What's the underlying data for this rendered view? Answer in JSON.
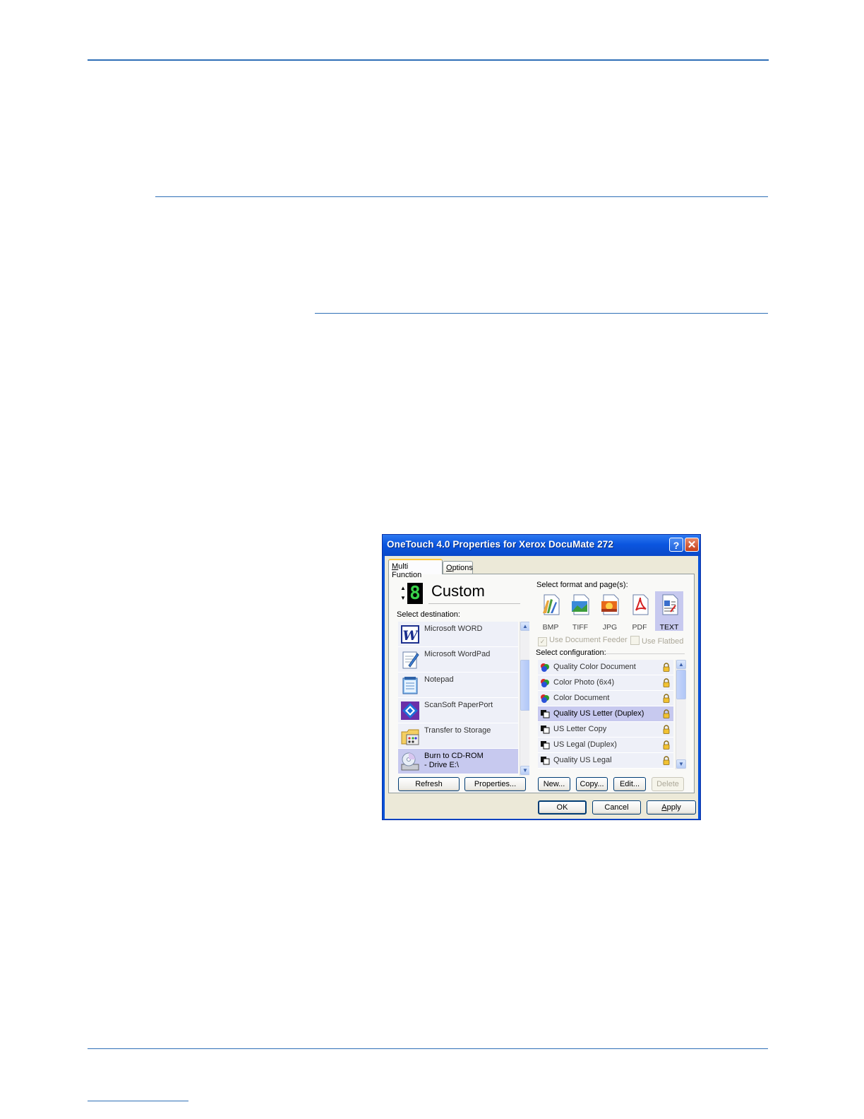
{
  "dialog": {
    "title": "OneTouch 4.0 Properties for Xerox DocuMate 272",
    "help_glyph": "?",
    "close_glyph": "✕",
    "tabs": [
      {
        "prefix": "",
        "accel": "M",
        "rest": "ulti Function"
      },
      {
        "prefix": "",
        "accel": "O",
        "rest": "ptions"
      }
    ],
    "button_number": "8",
    "spin_up": "▲",
    "spin_down": "▼",
    "profile_name": "Custom",
    "select_destination_label": "Select destination:",
    "destinations": [
      {
        "label": "Microsoft WORD",
        "icon": "word-icon",
        "selected": false
      },
      {
        "label": "Microsoft WordPad",
        "icon": "wordpad-icon",
        "selected": false
      },
      {
        "label": "Notepad",
        "icon": "notepad-icon",
        "selected": false
      },
      {
        "label": "ScanSoft PaperPort",
        "icon": "paperport-icon",
        "selected": false
      },
      {
        "label": "Transfer to Storage",
        "icon": "storage-folder-icon",
        "selected": false
      },
      {
        "label": "Burn to CD-ROM\n- Drive E:\\",
        "icon": "cd-burner-icon",
        "selected": true
      }
    ],
    "refresh_button": "Refresh",
    "properties_button": "Properties...",
    "select_format_label": "Select format and page(s):",
    "formats": [
      {
        "label": "BMP",
        "icon": "bmp-file-icon",
        "selected": false
      },
      {
        "label": "TIFF",
        "icon": "tiff-file-icon",
        "selected": false
      },
      {
        "label": "JPG",
        "icon": "jpg-file-icon",
        "selected": false
      },
      {
        "label": "PDF",
        "icon": "pdf-file-icon",
        "selected": false
      },
      {
        "label": "TEXT",
        "icon": "text-file-icon",
        "selected": true
      }
    ],
    "use_document_feeder": {
      "label": "Use Document Feeder",
      "checked": true,
      "mark": "✓"
    },
    "use_flatbed": {
      "label": "Use Flatbed",
      "checked": false
    },
    "select_configuration_label": "Select configuration:",
    "configurations": [
      {
        "label": "Quality Color Document",
        "icon": "color-config-icon",
        "selected": false
      },
      {
        "label": "Color Photo (6x4)",
        "icon": "color-config-icon",
        "selected": false
      },
      {
        "label": "Color Document",
        "icon": "color-config-icon",
        "selected": false
      },
      {
        "label": "Quality US Letter (Duplex)",
        "icon": "bw-config-icon",
        "selected": true
      },
      {
        "label": "US Letter Copy",
        "icon": "bw-config-icon",
        "selected": false
      },
      {
        "label": "US Legal (Duplex)",
        "icon": "bw-config-icon",
        "selected": false
      },
      {
        "label": "Quality US Legal",
        "icon": "bw-config-icon",
        "selected": false
      }
    ],
    "new_button": "New...",
    "copy_button": "Copy...",
    "edit_button": "Edit...",
    "delete_button": "Delete",
    "ok_button": "OK",
    "cancel_button": "Cancel",
    "apply_button": {
      "accel": "A",
      "rest": "pply"
    }
  },
  "colors": {
    "rule": "#2f6fb7",
    "title_bar": "#0b56e0",
    "selection": "#c7c9ef",
    "list_item": "#eef0f8",
    "led_digit": "#39d24a"
  }
}
